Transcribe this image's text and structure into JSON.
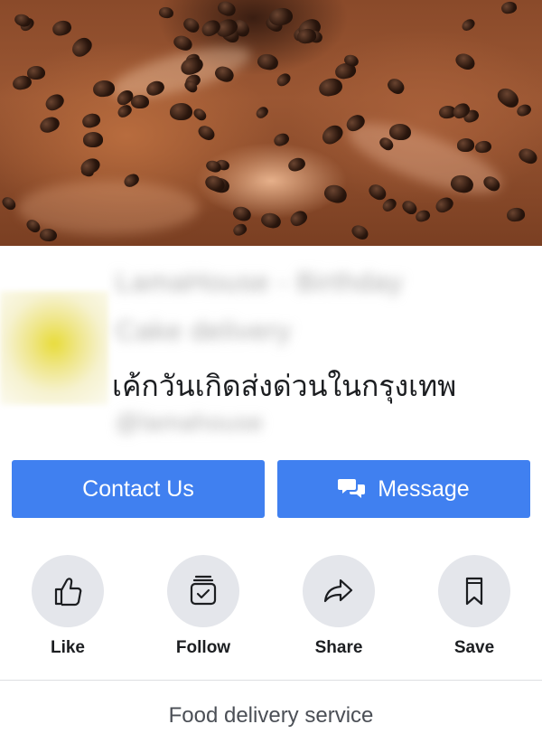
{
  "page": {
    "name_blurred": "LamaHouse - Birthday",
    "name_blurred_line2": "Cake delivery",
    "subtitle": "เค้กวันเกิดส่งด่วนในกรุงเทพ",
    "username_blurred": "@lamahouse"
  },
  "buttons": {
    "contact_label": "Contact Us",
    "message_label": "Message"
  },
  "actions": [
    {
      "label": "Like",
      "icon": "thumbs-up-icon"
    },
    {
      "label": "Follow",
      "icon": "follow-icon"
    },
    {
      "label": "Share",
      "icon": "share-icon"
    },
    {
      "label": "Save",
      "icon": "bookmark-icon"
    }
  ],
  "category": "Food delivery service",
  "colors": {
    "button_blue": "#4080f0",
    "action_circle": "#e4e6eb"
  }
}
